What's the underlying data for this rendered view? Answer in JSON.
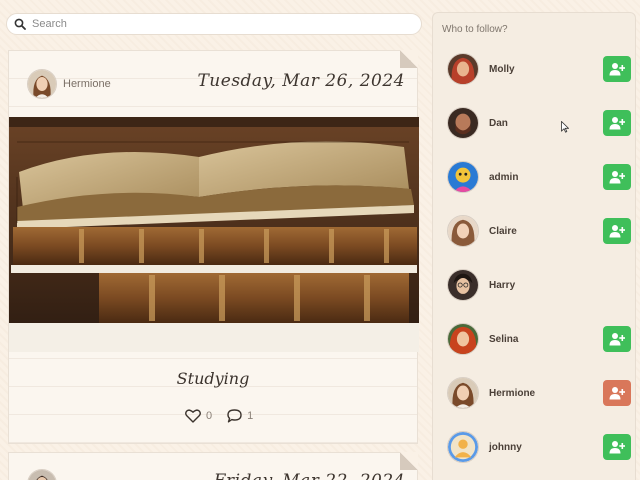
{
  "search": {
    "placeholder": "Search"
  },
  "feed": {
    "posts": [
      {
        "author": "Hermione",
        "date": "Tuesday, Mar 26, 2024",
        "caption": "Studying",
        "likes": "0",
        "comments": "1"
      },
      {
        "author": "",
        "date": "Friday, Mar 22, 2024"
      }
    ]
  },
  "sidebar": {
    "title": "Who to follow?",
    "users": [
      {
        "name": "Molly",
        "avatar": "red-hair-woman",
        "action": "follow",
        "button_color": "#3fbf5a"
      },
      {
        "name": "Dan",
        "avatar": "bearded-man",
        "action": "follow",
        "button_color": "#3fbf5a"
      },
      {
        "name": "admin",
        "avatar": "colorful-cartoon",
        "action": "follow",
        "button_color": "#3fbf5a"
      },
      {
        "name": "Claire",
        "avatar": "blonde-woman",
        "action": "follow",
        "button_color": "#3fbf5a"
      },
      {
        "name": "Harry",
        "avatar": "dark-hair-man",
        "action": "none",
        "button_color": ""
      },
      {
        "name": "Selina",
        "avatar": "red-curly-hair",
        "action": "follow",
        "button_color": "#3fbf5a"
      },
      {
        "name": "Hermione",
        "avatar": "brown-hair-woman",
        "action": "self",
        "button_color": "#d9775a"
      },
      {
        "name": "johnny",
        "avatar": "default-user",
        "action": "follow",
        "button_color": "#3fbf5a"
      }
    ]
  },
  "icons": {
    "search": "search-icon",
    "like": "heart-icon",
    "comment": "comment-icon",
    "follow": "user-plus-icon"
  }
}
